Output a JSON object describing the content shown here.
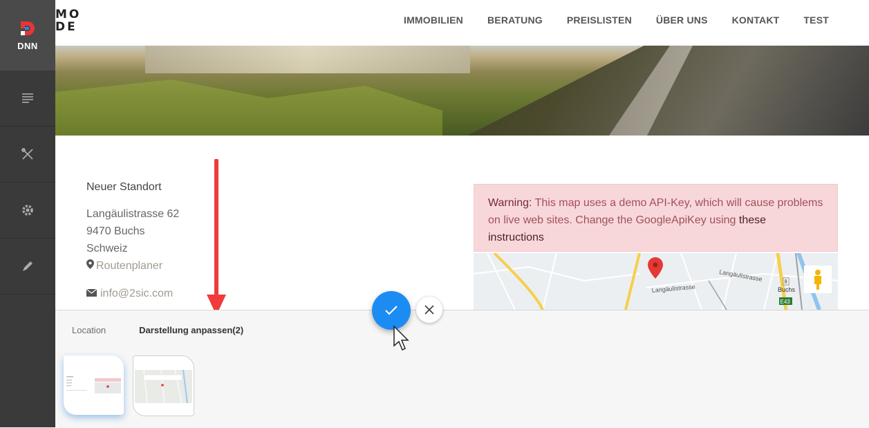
{
  "rail": {
    "logo_text": "DNN",
    "items": [
      {
        "icon": "page-icon"
      },
      {
        "icon": "tools-icon"
      },
      {
        "icon": "gear-icon"
      },
      {
        "icon": "pencil-icon"
      }
    ]
  },
  "header": {
    "brand_line1": "MO",
    "brand_line2": "DE",
    "nav": [
      "IMMOBILIEN",
      "BERATUNG",
      "PREISLISTEN",
      "ÜBER UNS",
      "KONTAKT",
      "TEST"
    ]
  },
  "location": {
    "title": "Neuer Standort",
    "street": "Langäulistrasse 62",
    "city": "9470 Buchs",
    "country": "Schweiz",
    "route_link": "Routenplaner",
    "email": "info@2sic.com"
  },
  "warning": {
    "label": "Warning:",
    "text": " This map uses a demo API-Key, which will cause problems on live web sites. Change the GoogleApiKey using ",
    "link": "these instructions"
  },
  "map": {
    "road_label_1": "Langäulistrasse",
    "road_label_2": "Langäulistrasse",
    "town_label": "Buchs",
    "route_shield": "8",
    "highway_shield": "E43"
  },
  "panel": {
    "tabs": [
      "Location",
      "Darstellung anpassen(2)"
    ],
    "active_tab": 1
  },
  "colors": {
    "accent": "#1b8cf2",
    "warning_bg": "#f8d7da",
    "rail_bg": "#3a3a3a"
  }
}
